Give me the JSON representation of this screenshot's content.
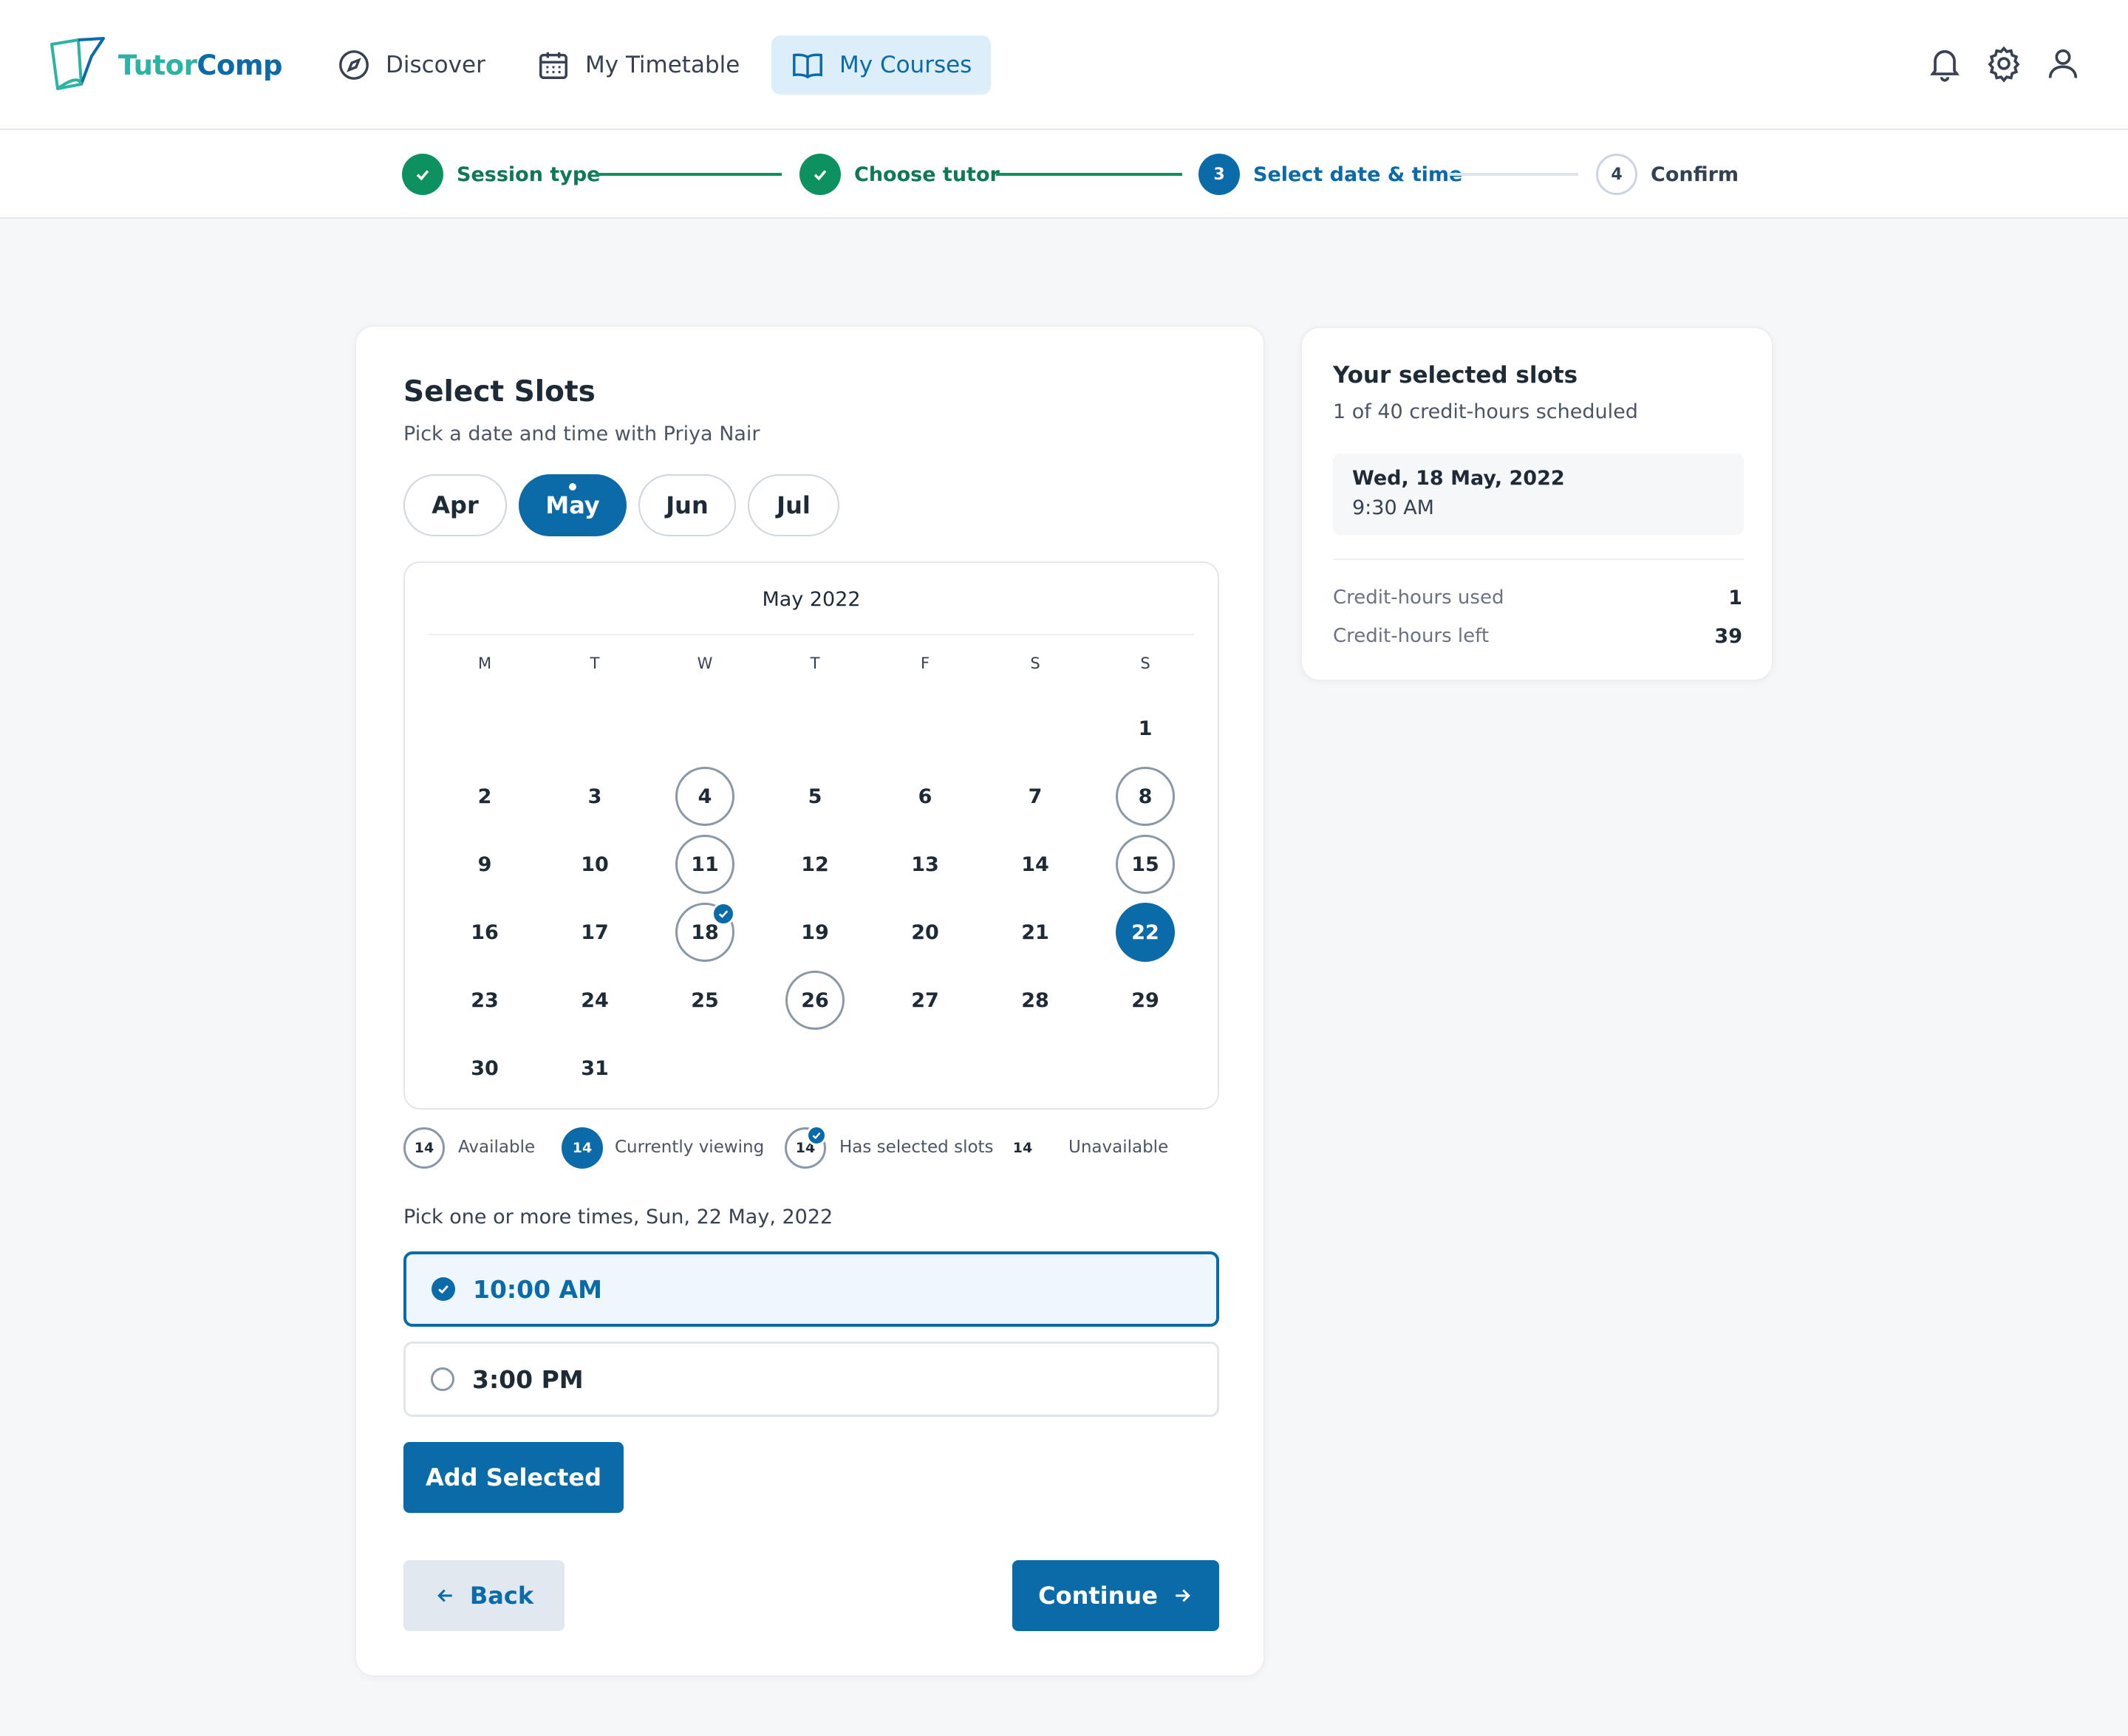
{
  "brand": {
    "name_part1": "Tutor",
    "name_part2": "Comp"
  },
  "nav": [
    {
      "label": "Discover",
      "icon": "compass-icon"
    },
    {
      "label": "My Timetable",
      "icon": "calendar-icon"
    },
    {
      "label": "My Courses",
      "icon": "book-icon",
      "active": true
    }
  ],
  "header_icons": [
    "bell-icon",
    "gear-icon",
    "user-icon"
  ],
  "stepper": [
    {
      "label": "Session type",
      "state": "done"
    },
    {
      "label": "Choose tutor",
      "state": "done"
    },
    {
      "number": "3",
      "label": "Select date & time",
      "state": "current"
    },
    {
      "number": "4",
      "label": "Confirm",
      "state": "todo"
    }
  ],
  "main": {
    "title": "Select Slots",
    "subtitle": "Pick a date and time with Priya Nair",
    "months": [
      "Apr",
      "May",
      "Jun",
      "Jul"
    ],
    "selected_month": "May",
    "calendar": {
      "title": "May 2022",
      "weekdays": [
        "M",
        "T",
        "W",
        "T",
        "F",
        "S",
        "S"
      ],
      "days": [
        "1",
        "2",
        "3",
        "4",
        "5",
        "6",
        "7",
        "8",
        "9",
        "10",
        "11",
        "12",
        "13",
        "14",
        "15",
        "16",
        "17",
        "18",
        "19",
        "20",
        "21",
        "22",
        "23",
        "24",
        "25",
        "26",
        "27",
        "28",
        "29",
        "30",
        "31"
      ],
      "available_days": [
        "4",
        "8",
        "11",
        "15",
        "18",
        "26"
      ],
      "viewing_day": "22",
      "has_selected_days": [
        "18"
      ]
    },
    "legend": [
      {
        "sample": "14",
        "label": "Available"
      },
      {
        "sample": "14",
        "label": "Currently viewing"
      },
      {
        "sample": "14",
        "label": "Has selected slots"
      },
      {
        "sample": "14",
        "label": "Unavailable"
      }
    ],
    "times_label": "Pick one or more times, Sun, 22 May, 2022",
    "times": [
      {
        "label": "10:00 AM",
        "selected": true
      },
      {
        "label": "3:00 PM",
        "selected": false
      }
    ],
    "add_button": "Add Selected",
    "back_button": "Back",
    "continue_button": "Continue"
  },
  "side": {
    "title": "Your selected slots",
    "subtitle": "1 of 40 credit-hours scheduled",
    "slot_date": "Wed, 18 May, 2022",
    "slot_time": "9:30 AM",
    "used_label": "Credit-hours used",
    "used_value": "1",
    "left_label": "Credit-hours left",
    "left_value": "39"
  },
  "colors": {
    "primary": "#0b6aa8",
    "success": "#0e9160",
    "brand_teal": "#2bb3a3"
  }
}
